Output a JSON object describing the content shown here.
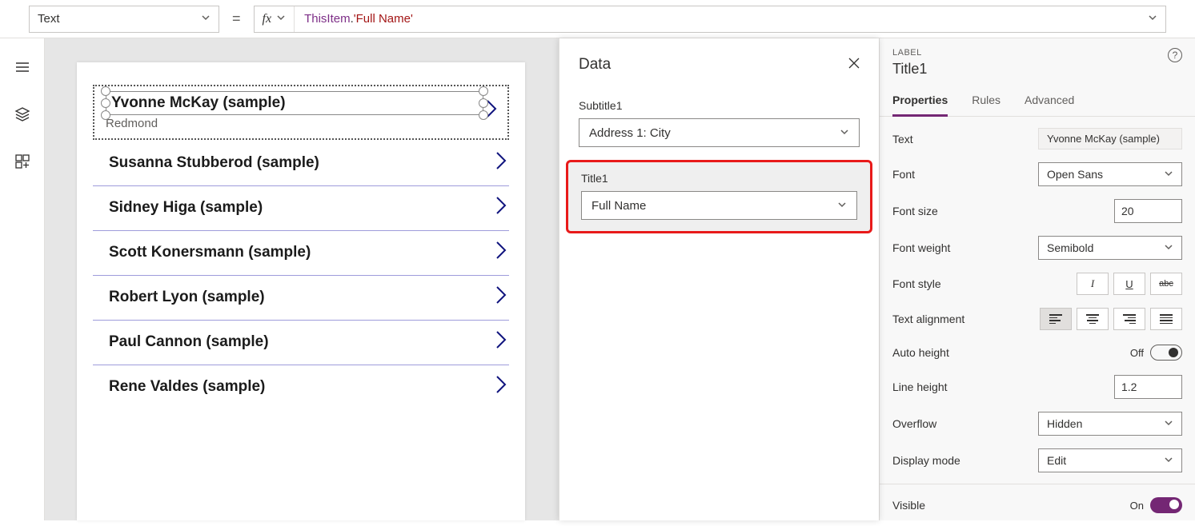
{
  "formula_bar": {
    "property": "Text",
    "this": "ThisItem",
    "dot": ".",
    "field": "'Full Name'"
  },
  "gallery": {
    "items": [
      {
        "title": "Yvonne McKay (sample)",
        "subtitle": "Redmond"
      },
      {
        "title": "Susanna Stubberod (sample)"
      },
      {
        "title": "Sidney Higa (sample)"
      },
      {
        "title": "Scott Konersmann (sample)"
      },
      {
        "title": "Robert Lyon (sample)"
      },
      {
        "title": "Paul Cannon (sample)"
      },
      {
        "title": "Rene Valdes (sample)"
      }
    ]
  },
  "data_panel": {
    "title": "Data",
    "subtitle1_label": "Subtitle1",
    "subtitle1_value": "Address 1: City",
    "title1_label": "Title1",
    "title1_value": "Full Name"
  },
  "props": {
    "type": "LABEL",
    "name": "Title1",
    "tabs": {
      "properties": "Properties",
      "rules": "Rules",
      "advanced": "Advanced"
    },
    "text_label": "Text",
    "text_value": "Yvonne McKay (sample)",
    "font_label": "Font",
    "font_value": "Open Sans",
    "fontsize_label": "Font size",
    "fontsize_value": "20",
    "fontweight_label": "Font weight",
    "fontweight_value": "Semibold",
    "fontstyle_label": "Font style",
    "italic": "I",
    "underline": "U",
    "strike": "abc",
    "align_label": "Text alignment",
    "autoheight_label": "Auto height",
    "off": "Off",
    "lineheight_label": "Line height",
    "lineheight_value": "1.2",
    "overflow_label": "Overflow",
    "overflow_value": "Hidden",
    "displaymode_label": "Display mode",
    "displaymode_value": "Edit",
    "visible_label": "Visible",
    "on": "On"
  }
}
